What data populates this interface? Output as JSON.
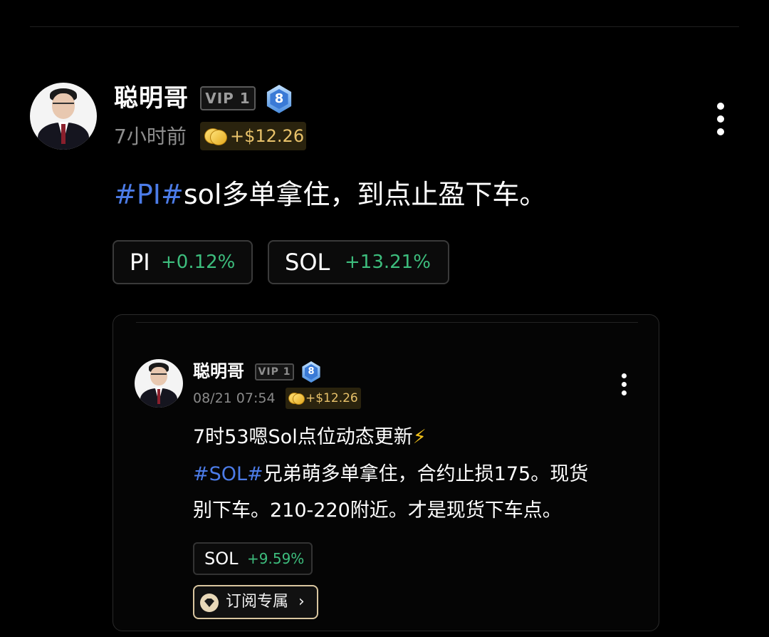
{
  "post": {
    "author": "聪明哥",
    "vip_label": "VIP 1",
    "level": "8",
    "time": "7小时前",
    "tip": "+$12.26",
    "text": {
      "hashtag": "#PI#",
      "body": "sol多单拿住，到点止盈下车。"
    },
    "coins": [
      {
        "symbol": "PI",
        "change": "+0.12%"
      },
      {
        "symbol": "SOL",
        "change": "+13.21%"
      }
    ]
  },
  "quoted": {
    "author": "聪明哥",
    "vip_label": "VIP 1",
    "level": "8",
    "time": "08/21 07:54",
    "tip": "+$12.26",
    "line1": "7时53嗯Sol点位动态更新",
    "line1_emoji": "⚡",
    "line2_hashtag": "#SOL#",
    "line2_body": "兄弟萌多单拿住，合约止损175。现货",
    "line3": "别下车。210-220附近。才是现货下车点。",
    "coin": {
      "symbol": "SOL",
      "change": "+9.59%"
    },
    "subscribe_label": "订阅专属",
    "subscribe_chevron": "›"
  },
  "colors": {
    "hashtag": "#4c7ce8",
    "positive": "#3dbd7d",
    "tip": "#e8c26a",
    "background": "#000000"
  },
  "icons": [
    "avatar",
    "vip-badge",
    "level-8-badge",
    "coin-icon",
    "more-vertical-icon",
    "lightning-icon",
    "diamond-icon",
    "chevron-right-icon"
  ]
}
